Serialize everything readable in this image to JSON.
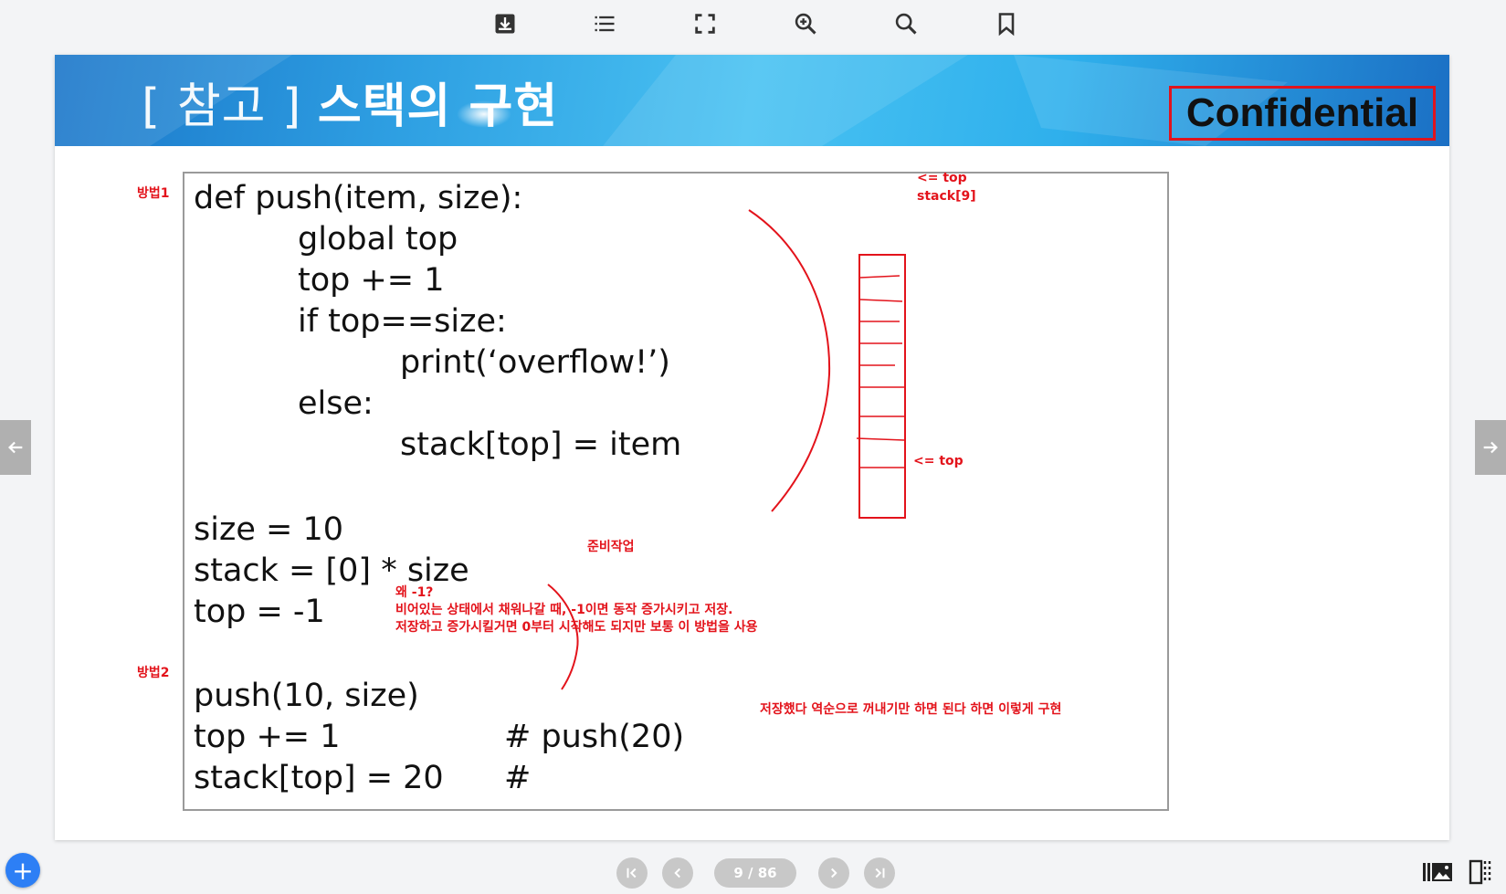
{
  "toolbar": {
    "icons": [
      "download-icon",
      "list-icon",
      "fullscreen-icon",
      "zoom-in-icon",
      "search-icon",
      "bookmark-icon"
    ]
  },
  "slide": {
    "title_bracket": "[ 참고 ]",
    "title_main": "스택의 구현",
    "confidential": "Confidential",
    "method1_label": "방법1",
    "method2_label": "방법2",
    "code_func": [
      "def push(item, size):",
      "global top",
      "top += 1",
      "if top==size:",
      "print(‘overflow!’)",
      "else:",
      "stack[top] = item"
    ],
    "code_setup": [
      "size = 10",
      "stack = [0] * size",
      "top = -1"
    ],
    "code_method2": [
      "push(10, size)",
      "top += 1",
      "stack[top] = 20"
    ],
    "code_comments": [
      "# push(20)",
      "#"
    ],
    "notes": {
      "top_arrow_upper": "<= top",
      "stack9": "stack[9]",
      "top_arrow_lower": "<= top",
      "prep": "준비작업",
      "why_minus_one": "왜 -1?\n비어있는 상태에서 채워나갈 때, -1이면 동작 증가시키고 저장.\n저장하고 증가시킬거면 0부터 시작해도 되지만 보통 이 방법을 사용",
      "reverse": "저장했다 역순으로 꺼내기만 하면 된다 하면 이렇게 구현"
    }
  },
  "navigation": {
    "page_indicator": "9 / 86",
    "first": "first-page-icon",
    "prev": "prev-page-icon",
    "next": "next-page-icon",
    "last": "last-page-icon",
    "add": "+"
  },
  "colors": {
    "annotation": "#e3131b",
    "fab": "#2d7ff5",
    "banner": "#2e9fe2"
  }
}
